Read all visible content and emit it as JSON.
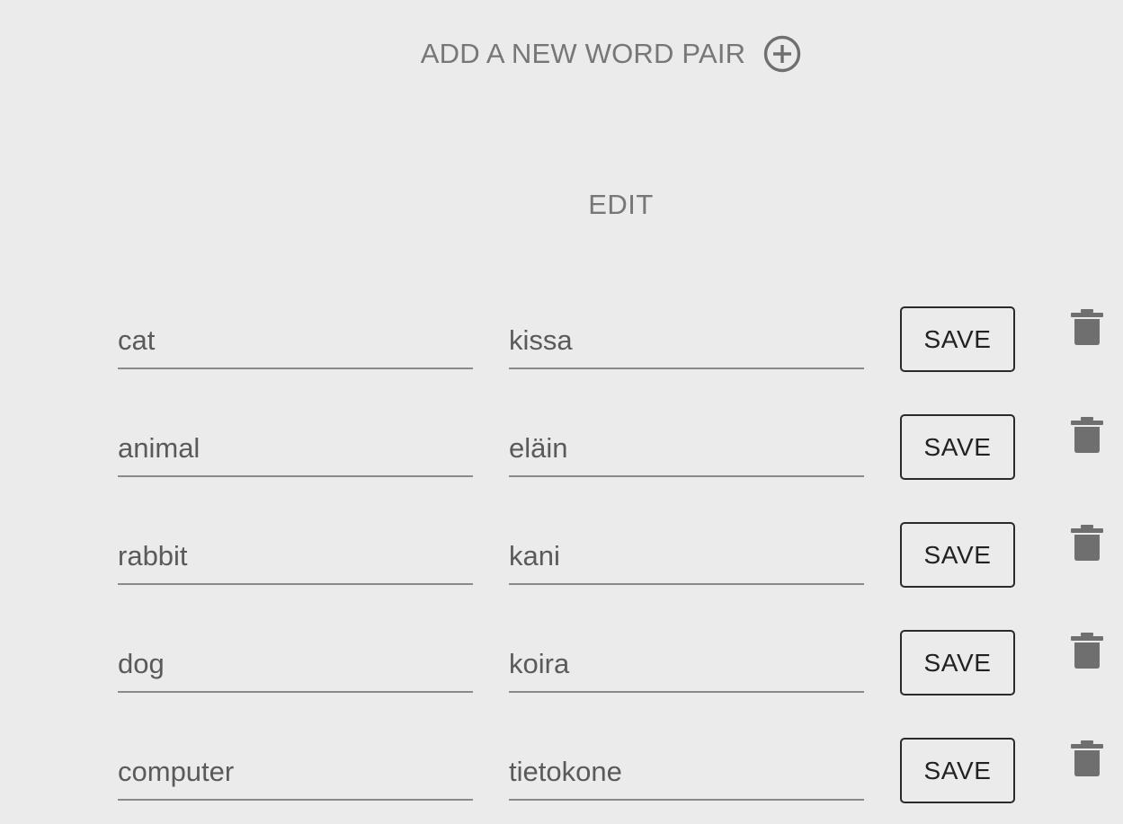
{
  "header": {
    "add_label": "ADD A NEW WORD PAIR",
    "add_icon": "plus-circle-icon"
  },
  "edit": {
    "title": "EDIT"
  },
  "rows": [
    {
      "word": "cat",
      "translation": "kissa",
      "save_label": "SAVE",
      "delete_icon": "trash-icon"
    },
    {
      "word": "animal",
      "translation": "eläin",
      "save_label": "SAVE",
      "delete_icon": "trash-icon"
    },
    {
      "word": "rabbit",
      "translation": "kani",
      "save_label": "SAVE",
      "delete_icon": "trash-icon"
    },
    {
      "word": "dog",
      "translation": "koira",
      "save_label": "SAVE",
      "delete_icon": "trash-icon"
    },
    {
      "word": "computer",
      "translation": "tietokone",
      "save_label": "SAVE",
      "delete_icon": "trash-icon"
    }
  ],
  "colors": {
    "background": "#ebebeb",
    "muted_text": "#777777",
    "field_text": "#5a5a5a",
    "underline": "#8a8a8a",
    "button_border": "#2a2a2a",
    "icon": "#6f6f6f"
  }
}
